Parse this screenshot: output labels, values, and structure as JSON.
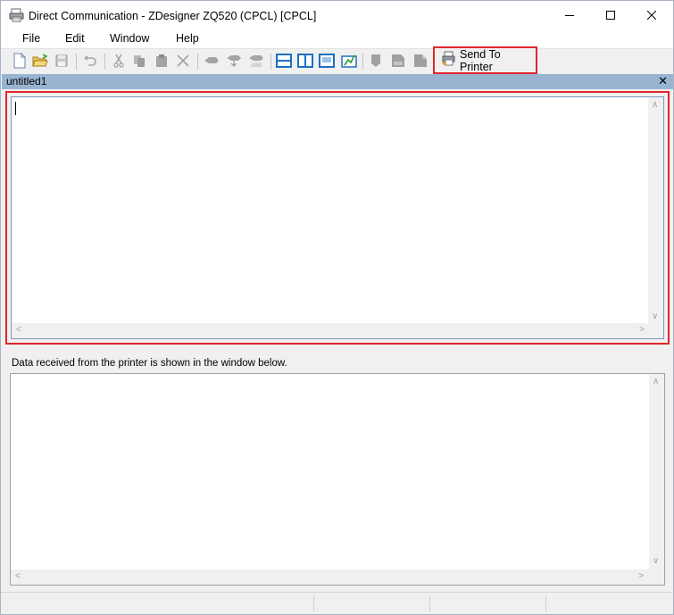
{
  "window": {
    "title": "Direct Communication - ZDesigner ZQ520 (CPCL) [CPCL]"
  },
  "menu": {
    "items": [
      {
        "label": "File"
      },
      {
        "label": "Edit"
      },
      {
        "label": "Window"
      },
      {
        "label": "Help"
      }
    ]
  },
  "toolbar": {
    "send_label": "Send To Printer",
    "icons": [
      "new-document-icon",
      "open-folder-icon",
      "save-icon",
      "undo-icon",
      "cut-icon",
      "copy-icon",
      "paste-icon",
      "delete-icon",
      "font-icon",
      "font-download-icon",
      "font-abc-icon",
      "layout-horizontal-icon",
      "layout-vertical-icon",
      "layout-single-icon",
      "layout-graph-icon",
      "printer-left-icon",
      "printer-middle-icon",
      "printer-right-icon"
    ]
  },
  "document": {
    "tab_title": "untitled1",
    "close_symbol": "✕",
    "editor_text": ""
  },
  "output": {
    "caption": "Data received from the printer is shown in the window below.",
    "text": ""
  },
  "colors": {
    "highlight": "#e0252d",
    "doc_header": "#99b4d1",
    "toolbar_blue": "#1c6fc4"
  }
}
